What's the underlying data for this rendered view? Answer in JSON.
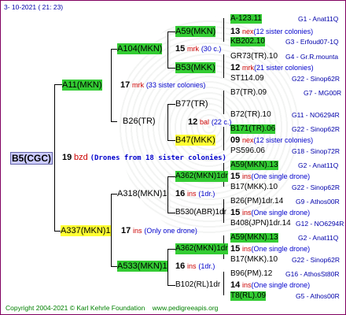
{
  "header": {
    "date": "3- 10-2021 ( 21: 23)"
  },
  "root": {
    "name": "B5(CGC)",
    "num": "19",
    "tag": "bzd",
    "note": "(Drones from 18 sister colonies)"
  },
  "gen1": [
    {
      "name": "A11(MKN)",
      "num": "17",
      "tag": "mrk",
      "note": "(33 sister colonies)"
    },
    {
      "name": "A337(MKN)1",
      "num": "17",
      "tag": "ins",
      "note": "(Only one drone)"
    }
  ],
  "gen2": [
    {
      "name": "A104(MKN)",
      "num": "15",
      "tag": "mrk",
      "note": "(30 c.)"
    },
    {
      "name": "B26(TR)",
      "num": "",
      "tag": "",
      "note": ""
    },
    {
      "name": "A318(MKN)1",
      "num": "16",
      "tag": "ins",
      "note": "(1dr.)"
    },
    {
      "name": "A533(MKN)1",
      "num": "16",
      "tag": "ins",
      "note": "(1dr.)"
    }
  ],
  "gen3": [
    {
      "name": "A59(MKN)",
      "num": "13",
      "tag": "nex",
      "note": "(12 sister colonies)"
    },
    {
      "name": "B53(MKK)",
      "num": "12",
      "tag": "mrk",
      "note": "(21 sister colonies)"
    },
    {
      "name": "B77(TR)",
      "num": "12",
      "tag": "bal",
      "note": "(22 c.)"
    },
    {
      "name": "B47(MKK)",
      "num": "09",
      "tag": "nex",
      "note": "(12 sister colonies)"
    },
    {
      "name": "A362(MKN)1dr",
      "num": "15",
      "tag": "ins",
      "note": "(One single drone)"
    },
    {
      "name": "B530(ABR)1dr",
      "num": "15",
      "tag": "ins",
      "note": "(One single drone)"
    },
    {
      "name": "A362(MKN)1dr",
      "num": "15",
      "tag": "ins",
      "note": "(One single drone)"
    },
    {
      "name": "B102(RL)1dr",
      "num": "14",
      "tag": "ins",
      "note": "(One single drone)"
    }
  ],
  "gen4": [
    {
      "name": "A-123.11",
      "info": "G1 - Anat11Q"
    },
    {
      "name": "KB202.10",
      "info": "G3 - Erfoud07-1Q"
    },
    {
      "name": "GR73(TR).10",
      "info": "G4 - Gr.R.mounta"
    },
    {
      "name": "ST114.09",
      "info": "G22 - Sinop62R"
    },
    {
      "name": "B7(TR).09",
      "info": "G7 - MG00R"
    },
    {
      "name": "B72(TR).10",
      "info": "G11 - NO6294R"
    },
    {
      "name": "B171(TR).06",
      "info": "G22 - Sinop62R"
    },
    {
      "name": "PS596.06",
      "info": "G18 - Sinop72R"
    },
    {
      "name": "A59(MKN).13",
      "info": "G2 - Anat11Q"
    },
    {
      "name": "B17(MKK).10",
      "info": "G22 - Sinop62R"
    },
    {
      "name": "B26(PM)1dr.14",
      "info": "G9 - Athos00R"
    },
    {
      "name": "B408(JPN)1dr.14",
      "info": "G12 - NO6294R"
    },
    {
      "name": "A59(MKN).13",
      "info": "G2 - Anat11Q"
    },
    {
      "name": "B17(MKK).10",
      "info": "G22 - Sinop62R"
    },
    {
      "name": "B96(PM).12",
      "info": "G16 - AthosSt80R"
    },
    {
      "name": "T8(RL).09",
      "info": "G5 - Athos00R"
    }
  ],
  "footer": {
    "copyright": "Copyright 2004-2021 © Karl Kehrle Foundation",
    "url": "www.pedigreeapis.org"
  }
}
